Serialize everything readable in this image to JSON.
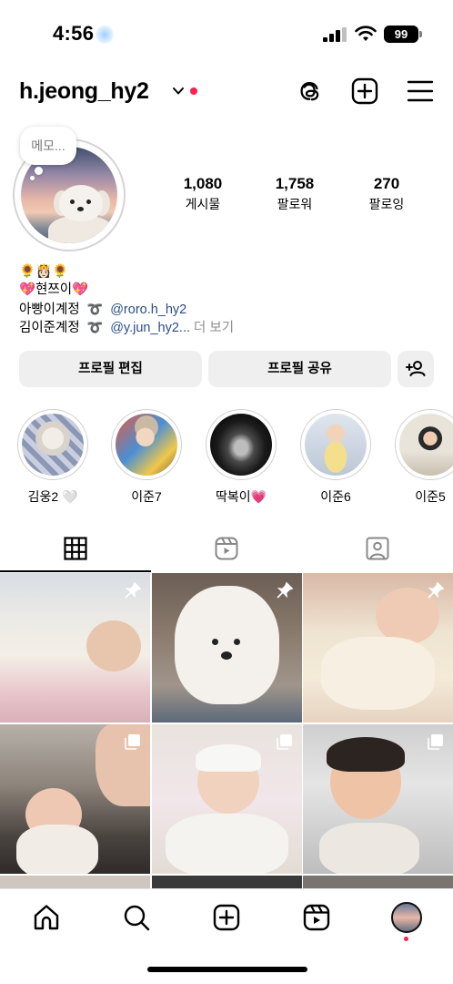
{
  "status_bar": {
    "time": "4:56",
    "battery": "99"
  },
  "header": {
    "username": "h.jeong_hy2",
    "icons": [
      "chevron-down-icon",
      "threads-icon",
      "create-plus-icon",
      "menu-icon"
    ]
  },
  "profile": {
    "memo_placeholder": "메모...",
    "stats": [
      {
        "value": "1,080",
        "label": "게시물"
      },
      {
        "value": "1,758",
        "label": "팔로워"
      },
      {
        "value": "270",
        "label": "팔로잉"
      }
    ],
    "bio": {
      "line1": "🌻👸🏻🌻",
      "line2": "💖현쯔이💖",
      "line3_prefix": "아빵이계정",
      "line3_link": "@roro.h_hy2",
      "line4_prefix": "김이준계정",
      "line4_link": "@y.jun_hy2...",
      "more": "더 보기",
      "thread_mark": "➰"
    }
  },
  "actions": {
    "edit_profile": "프로필 편집",
    "share_profile": "프로필 공유"
  },
  "highlights": [
    {
      "label": "김웅2 🤍"
    },
    {
      "label": "이준7"
    },
    {
      "label": "딱복이💗"
    },
    {
      "label": "이준6"
    },
    {
      "label": "이준5"
    }
  ],
  "tabs": [
    "grid-tab",
    "reels-tab",
    "tagged-tab"
  ],
  "colors": {
    "accent_red": "#ff1f4b",
    "link_blue": "#2a4f8a",
    "button_bg": "#efefef"
  }
}
